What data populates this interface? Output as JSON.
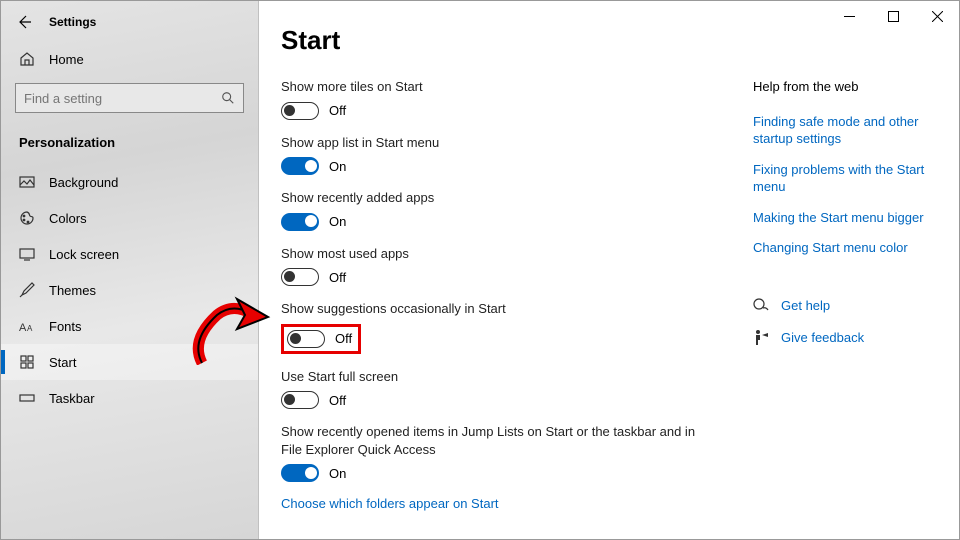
{
  "window": {
    "title": "Settings"
  },
  "sidebar": {
    "home": "Home",
    "search_placeholder": "Find a setting",
    "section": "Personalization",
    "items": [
      {
        "label": "Background"
      },
      {
        "label": "Colors"
      },
      {
        "label": "Lock screen"
      },
      {
        "label": "Themes"
      },
      {
        "label": "Fonts"
      },
      {
        "label": "Start"
      },
      {
        "label": "Taskbar"
      }
    ]
  },
  "page": {
    "title": "Start",
    "settings": [
      {
        "label": "Show more tiles on Start",
        "state": "Off",
        "on": false
      },
      {
        "label": "Show app list in Start menu",
        "state": "On",
        "on": true
      },
      {
        "label": "Show recently added apps",
        "state": "On",
        "on": true
      },
      {
        "label": "Show most used apps",
        "state": "Off",
        "on": false
      },
      {
        "label": "Show suggestions occasionally in Start",
        "state": "Off",
        "on": false,
        "highlighted": true
      },
      {
        "label": "Use Start full screen",
        "state": "Off",
        "on": false
      },
      {
        "label": "Show recently opened items in Jump Lists on Start or the taskbar and in File Explorer Quick Access",
        "state": "On",
        "on": true
      }
    ],
    "footer_link": "Choose which folders appear on Start"
  },
  "aside": {
    "heading": "Help from the web",
    "links": [
      "Finding safe mode and other startup settings",
      "Fixing problems with the Start menu",
      "Making the Start menu bigger",
      "Changing Start menu color"
    ],
    "get_help": "Get help",
    "feedback": "Give feedback"
  }
}
